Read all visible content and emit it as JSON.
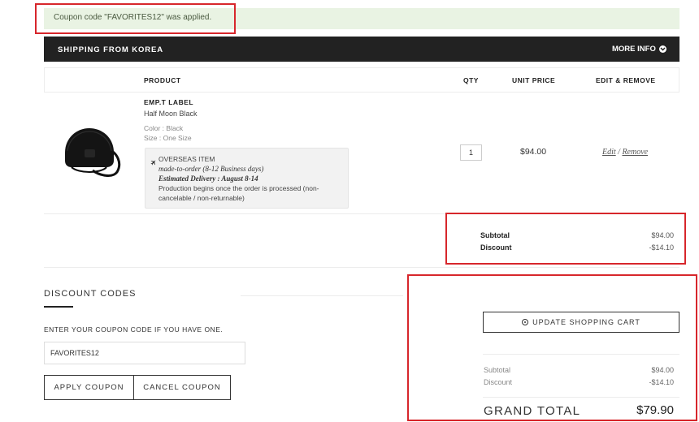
{
  "notice": {
    "text": "Coupon code \"FAVORITES12\" was applied."
  },
  "shipping": {
    "title": "SHIPPING FROM KOREA",
    "more_info": "MORE INFO"
  },
  "table": {
    "headers": {
      "product": "PRODUCT",
      "qty": "QTY",
      "unit_price": "UNIT PRICE",
      "edit_remove": "EDIT & REMOVE"
    }
  },
  "item": {
    "brand": "EMP.T LABEL",
    "name": "Half Moon Black",
    "color": "Color : Black",
    "size": "Size : One Size",
    "overseas": {
      "title": "OVERSEAS ITEM",
      "made_to_order": "made-to-order (8-12 Business days)",
      "delivery": "Estimated Delivery : August 8-14",
      "note_line1": "Production begins once the order is processed (non-",
      "note_line2": "cancelable / non-returnable)"
    },
    "qty": "1",
    "unit_price": "$94.00",
    "edit": "Edit",
    "separator": "/",
    "remove": "Remove"
  },
  "summary": {
    "subtotal_label": "Subtotal",
    "subtotal": "$94.00",
    "discount_label": "Discount",
    "discount": "-$14.10"
  },
  "discount_codes": {
    "title": "DISCOUNT CODES",
    "instruction": "ENTER YOUR COUPON CODE IF YOU HAVE ONE.",
    "code_value": "FAVORITES12",
    "apply_label": "APPLY COUPON",
    "cancel_label": "CANCEL COUPON"
  },
  "totals": {
    "update_label": "UPDATE SHOPPING CART",
    "subtotal_label": "Subtotal",
    "subtotal": "$94.00",
    "discount_label": "Discount",
    "discount": "-$14.10",
    "grand_total_label": "GRAND TOTAL",
    "grand_total": "$79.90"
  },
  "colors": {
    "highlight": "#d7262b",
    "notice_bg": "#e9f3e3",
    "header_bar": "#222222"
  },
  "icons": {
    "more_info": "chevron-down-circle-icon",
    "overseas": "airplane-icon",
    "update": "refresh-icon"
  }
}
